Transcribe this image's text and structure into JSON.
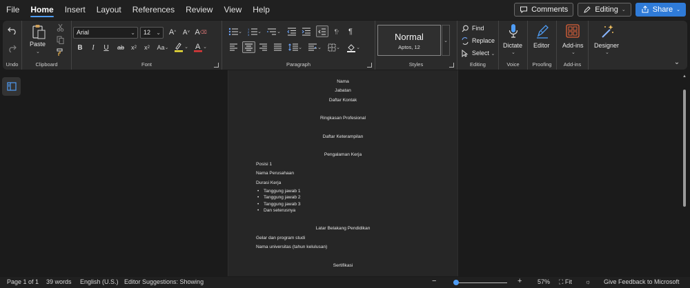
{
  "menu": {
    "items": [
      "File",
      "Home",
      "Insert",
      "Layout",
      "References",
      "Review",
      "View",
      "Help"
    ],
    "active": "Home",
    "comments_label": "Comments",
    "editing_label": "Editing",
    "share_label": "Share"
  },
  "ribbon": {
    "undo": {
      "group_label": "Undo"
    },
    "clipboard": {
      "paste_label": "Paste",
      "group_label": "Clipboard"
    },
    "font": {
      "family": "Arial",
      "size": "12",
      "group_label": "Font"
    },
    "paragraph": {
      "group_label": "Paragraph"
    },
    "styles": {
      "style_name": "Normal",
      "style_sub": "Aptos, 12",
      "group_label": "Styles"
    },
    "editing": {
      "find_label": "Find",
      "replace_label": "Replace",
      "select_label": "Select",
      "group_label": "Editing"
    },
    "voice": {
      "dictate_label": "Dictate",
      "group_label": "Voice"
    },
    "proofing": {
      "editor_label": "Editor",
      "group_label": "Proofing"
    },
    "addins": {
      "addins_label": "Add-ins",
      "group_label": "Add-ins"
    },
    "designer": {
      "designer_label": "Designer"
    }
  },
  "document": {
    "lines": {
      "nama": "Nama",
      "jabatan": "Jabatan",
      "daftar_kontak": "Daftar Kontak",
      "ringkasan": "Ringkasan Profesional",
      "keterampilan": "Daftar Keterampilan",
      "pengalaman": "Pengalaman Kerja",
      "posisi": "Posisi 1",
      "perusahaan": "Nama Perusahaan",
      "durasi": "Durasi Kerja",
      "latar": "Latar Belakang Pendidikan",
      "gelar": "Gelar dan program studi",
      "universitas": "Nama universitas (tahun kelulusan)",
      "sertifikasi": "Sertifikasi"
    },
    "bullets": [
      "Tanggung jawab 1",
      "Tanggung jawab 2",
      "Tanggung jawab 3",
      "Dan seterusnya"
    ]
  },
  "status": {
    "page": "Page 1 of 1",
    "words": "39 words",
    "language": "English (U.S.)",
    "editor_suggestions": "Editor Suggestions: Showing",
    "zoom": "57%",
    "fit_label": "Fit",
    "feedback": "Give Feedback to Microsoft",
    "zoom_fraction": 0.05
  },
  "colors": {
    "accent": "#2f7bd8",
    "zoom_thumb": "#4f9df5",
    "dictate_blue": "#4f9df5",
    "addins_orange": "#e0623a"
  }
}
